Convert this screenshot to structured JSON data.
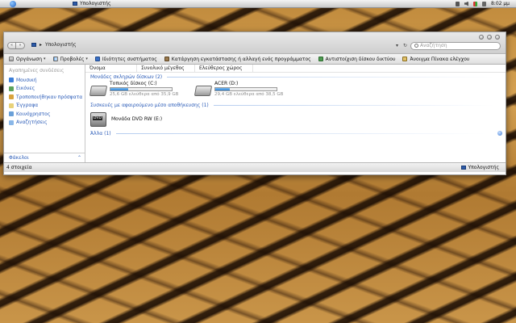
{
  "menubar": {
    "title": "Υπολογιστής",
    "clock": "8:02 μμ",
    "icons": [
      "apple-icon",
      "computer-icon",
      "speaker-icon",
      "flag-icon",
      "tray-icon"
    ]
  },
  "window": {
    "address": "Υπολογιστής",
    "search_placeholder": "Αναζήτηση",
    "nav": {
      "back": "«",
      "forward": "»",
      "dropdown": "▾",
      "refresh": "↻"
    }
  },
  "toolbar": {
    "organize": "Οργάνωση",
    "views": "Προβολές",
    "system_properties": "Ιδιότητες συστήματος",
    "uninstall": "Κατάργηση εγκατάστασης ή αλλαγή ενός προγράμματος",
    "map_drive": "Αντιστοίχιση δίσκου δικτύου",
    "control_panel": "Άνοιγμα Πίνακα ελέγχου",
    "chevron": "▾"
  },
  "sidebar": {
    "header": "Αγαπημένες συνδέσεις",
    "items": [
      {
        "label": "Μουσική",
        "icon": "music-icon"
      },
      {
        "label": "Εικόνες",
        "icon": "pictures-icon"
      },
      {
        "label": "Τροποποιήθηκαν πρόσφατα",
        "icon": "recent-icon"
      },
      {
        "label": "Έγγραφα",
        "icon": "documents-icon"
      },
      {
        "label": "Κοινόχρηστος",
        "icon": "public-icon"
      },
      {
        "label": "Αναζητήσεις",
        "icon": "searches-icon"
      }
    ],
    "folders": "Φάκελοι",
    "folders_chevron": "⌃"
  },
  "columns": [
    "Όνομα",
    "Συνολικό μέγεθος",
    "Ελεύθερος χώρος"
  ],
  "groups": {
    "hdd": "Μονάδες σκληρών δίσκων (2)",
    "removable": "Συσκευές με αφαιρούμενο μέσο αποθήκευσης (1)",
    "other": "Άλλα (1)"
  },
  "drives": [
    {
      "name": "Τοπικός δίσκος (C:)",
      "free_text": "25,6 GB ελεύθερα από 35,9 GB",
      "used_fraction": 0.287
    },
    {
      "name": "ACER (D:)",
      "free_text": "29,4 GB ελεύθερα από 38,5 GB",
      "used_fraction": 0.236
    }
  ],
  "dvd": {
    "name": "Μονάδα DVD RW (E:)"
  },
  "status": {
    "count": "4 στοιχεία",
    "location": "Υπολογιστής"
  },
  "colors": {
    "link": "#2b5cb8",
    "bar_fill": "#2f83d6"
  }
}
